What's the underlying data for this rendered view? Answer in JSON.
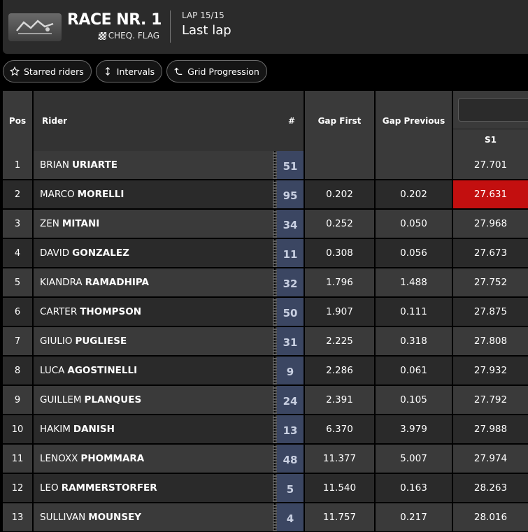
{
  "header": {
    "race_title": "RACE NR. 1",
    "flag_status": "CHEQ. FLAG",
    "lap_label": "LAP 15/15",
    "lap_status": "Last lap"
  },
  "filters": [
    {
      "label": "Starred riders",
      "icon": "star-icon"
    },
    {
      "label": "Intervals",
      "icon": "up-down-arrow-icon"
    },
    {
      "label": "Grid Progression",
      "icon": "progression-icon"
    }
  ],
  "columns": {
    "pos": "Pos",
    "rider": "Rider",
    "number": "#",
    "gap_first": "Gap First",
    "gap_previous": "Gap Previous",
    "s1": "S1"
  },
  "colors": {
    "best_sector": "#c30f0f",
    "number_bg": "#3b4662"
  },
  "rows": [
    {
      "pos": "1",
      "first": "BRIAN",
      "last": "URIARTE",
      "num": "51",
      "gap_first": "",
      "gap_previous": "",
      "s1": "27.701"
    },
    {
      "pos": "2",
      "first": "MARCO",
      "last": "MORELLI",
      "num": "95",
      "gap_first": "0.202",
      "gap_previous": "0.202",
      "s1": "27.631",
      "best": true
    },
    {
      "pos": "3",
      "first": "ZEN",
      "last": "MITANI",
      "num": "34",
      "gap_first": "0.252",
      "gap_previous": "0.050",
      "s1": "27.968"
    },
    {
      "pos": "4",
      "first": "DAVID",
      "last": "GONZALEZ",
      "num": "11",
      "gap_first": "0.308",
      "gap_previous": "0.056",
      "s1": "27.673"
    },
    {
      "pos": "5",
      "first": "KIANDRA",
      "last": "RAMADHIPA",
      "num": "32",
      "gap_first": "1.796",
      "gap_previous": "1.488",
      "s1": "27.752"
    },
    {
      "pos": "6",
      "first": "CARTER",
      "last": "THOMPSON",
      "num": "50",
      "gap_first": "1.907",
      "gap_previous": "0.111",
      "s1": "27.875"
    },
    {
      "pos": "7",
      "first": "GIULIO",
      "last": "PUGLIESE",
      "num": "31",
      "gap_first": "2.225",
      "gap_previous": "0.318",
      "s1": "27.808"
    },
    {
      "pos": "8",
      "first": "LUCA",
      "last": "AGOSTINELLI",
      "num": "9",
      "gap_first": "2.286",
      "gap_previous": "0.061",
      "s1": "27.932"
    },
    {
      "pos": "9",
      "first": "GUILLEM",
      "last": "PLANQUES",
      "num": "24",
      "gap_first": "2.391",
      "gap_previous": "0.105",
      "s1": "27.792"
    },
    {
      "pos": "10",
      "first": "HAKIM",
      "last": "DANISH",
      "num": "13",
      "gap_first": "6.370",
      "gap_previous": "3.979",
      "s1": "27.988"
    },
    {
      "pos": "11",
      "first": "LENOXX",
      "last": "PHOMMARA",
      "num": "48",
      "gap_first": "11.377",
      "gap_previous": "5.007",
      "s1": "27.974"
    },
    {
      "pos": "12",
      "first": "LEO",
      "last": "RAMMERSTORFER",
      "num": "5",
      "gap_first": "11.540",
      "gap_previous": "0.163",
      "s1": "28.263"
    },
    {
      "pos": "13",
      "first": "SULLIVAN",
      "last": "MOUNSEY",
      "num": "4",
      "gap_first": "11.757",
      "gap_previous": "0.217",
      "s1": "28.016"
    }
  ]
}
